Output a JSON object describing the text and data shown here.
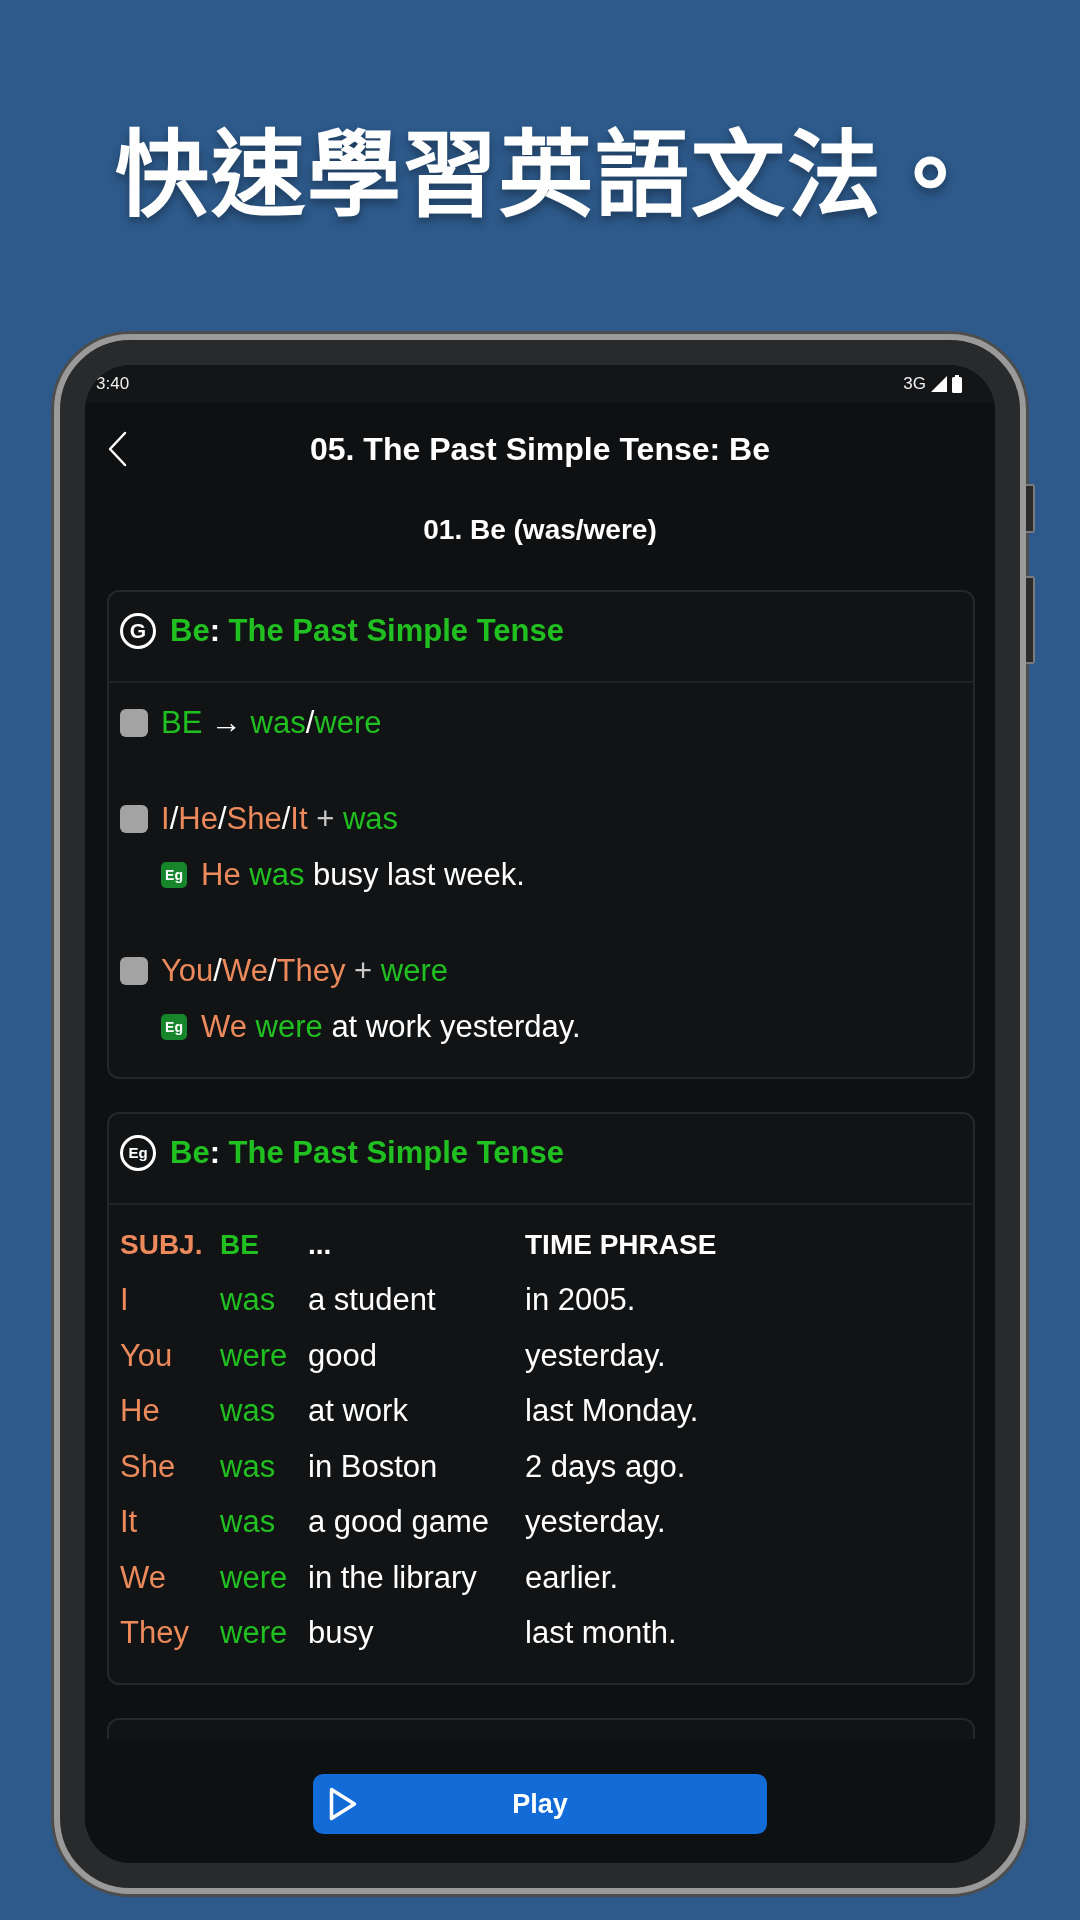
{
  "headline": "快速學習英語文法。",
  "status_bar": {
    "time": "3:40",
    "network": "3G"
  },
  "app_bar": {
    "title": "05. The Past Simple Tense: Be"
  },
  "lesson_title": "01. Be (was/were)",
  "cards": [
    {
      "kind": "rules",
      "symbol": "G",
      "title": [
        {
          "text": "Be",
          "kind": "verb"
        },
        {
          "text": ":",
          "kind": "plain"
        },
        {
          "text": " The Past Simple Tense",
          "kind": "verb"
        }
      ],
      "rules": [
        {
          "text": [
            {
              "text": "BE",
              "kind": "verb"
            },
            {
              "text": " → ",
              "kind": "plain"
            },
            {
              "text": "was",
              "kind": "verb"
            },
            {
              "text": "/",
              "kind": "plain"
            },
            {
              "text": "were",
              "kind": "verb"
            }
          ]
        },
        {
          "text": [
            {
              "text": "I",
              "kind": "subject"
            },
            {
              "text": "/",
              "kind": "plain"
            },
            {
              "text": "He",
              "kind": "subject"
            },
            {
              "text": "/",
              "kind": "plain"
            },
            {
              "text": "She",
              "kind": "subject"
            },
            {
              "text": "/",
              "kind": "plain"
            },
            {
              "text": "It",
              "kind": "subject"
            },
            {
              "text": " + ",
              "kind": "operator"
            },
            {
              "text": "was",
              "kind": "verb"
            }
          ],
          "example": {
            "tag": "Eg",
            "text": [
              {
                "text": "He",
                "kind": "subject"
              },
              {
                "text": " was",
                "kind": "verb"
              },
              {
                "text": " busy last week.",
                "kind": "plain"
              }
            ]
          }
        },
        {
          "text": [
            {
              "text": "You",
              "kind": "subject"
            },
            {
              "text": "/",
              "kind": "plain"
            },
            {
              "text": "We",
              "kind": "subject"
            },
            {
              "text": "/",
              "kind": "plain"
            },
            {
              "text": "They",
              "kind": "subject"
            },
            {
              "text": " + ",
              "kind": "operator"
            },
            {
              "text": "were",
              "kind": "verb"
            }
          ],
          "example": {
            "tag": "Eg",
            "text": [
              {
                "text": "We",
                "kind": "subject"
              },
              {
                "text": " were",
                "kind": "verb"
              },
              {
                "text": " at work yesterday.",
                "kind": "plain"
              }
            ]
          }
        }
      ]
    },
    {
      "kind": "table",
      "symbol": "Eg",
      "title": [
        {
          "text": "Be",
          "kind": "verb"
        },
        {
          "text": ":",
          "kind": "plain"
        },
        {
          "text": " The Past Simple Tense",
          "kind": "verb"
        }
      ],
      "table": {
        "columns": [
          {
            "label": "SUBJ.",
            "kind": "subject"
          },
          {
            "label": "BE",
            "kind": "verb"
          },
          {
            "label": "...",
            "kind": "plain"
          },
          {
            "label": "TIME PHRASE",
            "kind": "plain"
          }
        ],
        "rows": [
          [
            "I",
            "was",
            "a student",
            "in 2005."
          ],
          [
            "You",
            "were",
            "good",
            "yesterday."
          ],
          [
            "He",
            "was",
            "at work",
            "last Monday."
          ],
          [
            "She",
            "was",
            "in Boston",
            "2 days ago."
          ],
          [
            "It",
            "was",
            "a good game",
            "yesterday."
          ],
          [
            "We",
            "were",
            "in the library",
            "earlier."
          ],
          [
            "They",
            "were",
            "busy",
            "last month."
          ]
        ]
      }
    }
  ],
  "play_button": {
    "label": "Play"
  }
}
